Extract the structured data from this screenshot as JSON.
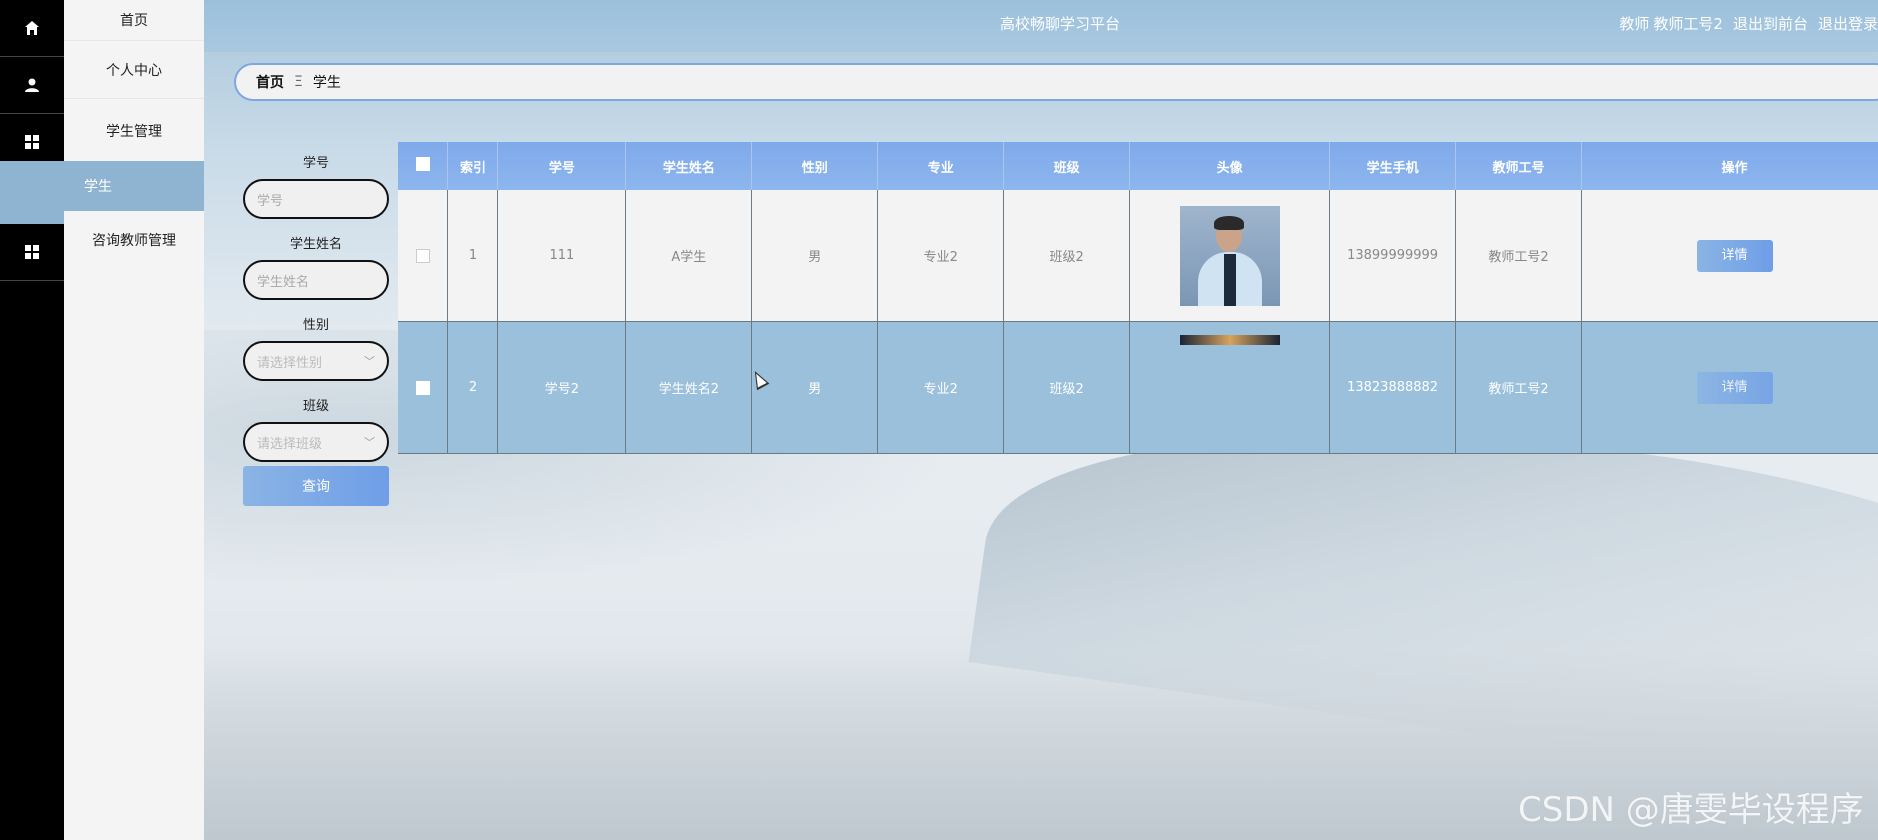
{
  "header": {
    "title": "高校畅聊学习平台",
    "user_role": "教师",
    "user_name": "教师工号2",
    "to_front": "退出到前台",
    "logout": "退出登录"
  },
  "sidebar": {
    "items": [
      {
        "label": "首页",
        "icon": "home-icon"
      },
      {
        "label": "个人中心",
        "icon": "user-icon"
      },
      {
        "label": "学生管理",
        "icon": "grid-icon"
      },
      {
        "label": "学生",
        "icon": ""
      },
      {
        "label": "咨询教师管理",
        "icon": "grid-icon"
      }
    ]
  },
  "breadcrumb": {
    "home": "首页",
    "separator": "Ξ",
    "current": "学生"
  },
  "search": {
    "student_no_label": "学号",
    "student_no_placeholder": "学号",
    "student_name_label": "学生姓名",
    "student_name_placeholder": "学生姓名",
    "gender_label": "性别",
    "gender_placeholder": "请选择性别",
    "class_label": "班级",
    "class_placeholder": "请选择班级",
    "query_button": "查询"
  },
  "table": {
    "columns": [
      "索引",
      "学号",
      "学生姓名",
      "性别",
      "专业",
      "班级",
      "头像",
      "学生手机",
      "教师工号",
      "操作"
    ],
    "rows": [
      {
        "index": "1",
        "student_no": "111",
        "name": "A学生",
        "gender": "男",
        "major": "专业2",
        "class": "班级2",
        "phone": "13899999999",
        "teacher_no": "教师工号2",
        "action": "详情"
      },
      {
        "index": "2",
        "student_no": "学号2",
        "name": "学生姓名2",
        "gender": "男",
        "major": "专业2",
        "class": "班级2",
        "phone": "13823888882",
        "teacher_no": "教师工号2",
        "action": "详情"
      }
    ]
  },
  "watermark": "CSDN @唐雯毕设程序",
  "colors": {
    "accent": "#8fb4d2",
    "header": "#9cc0dc",
    "table_header": "#7fa9ea"
  }
}
